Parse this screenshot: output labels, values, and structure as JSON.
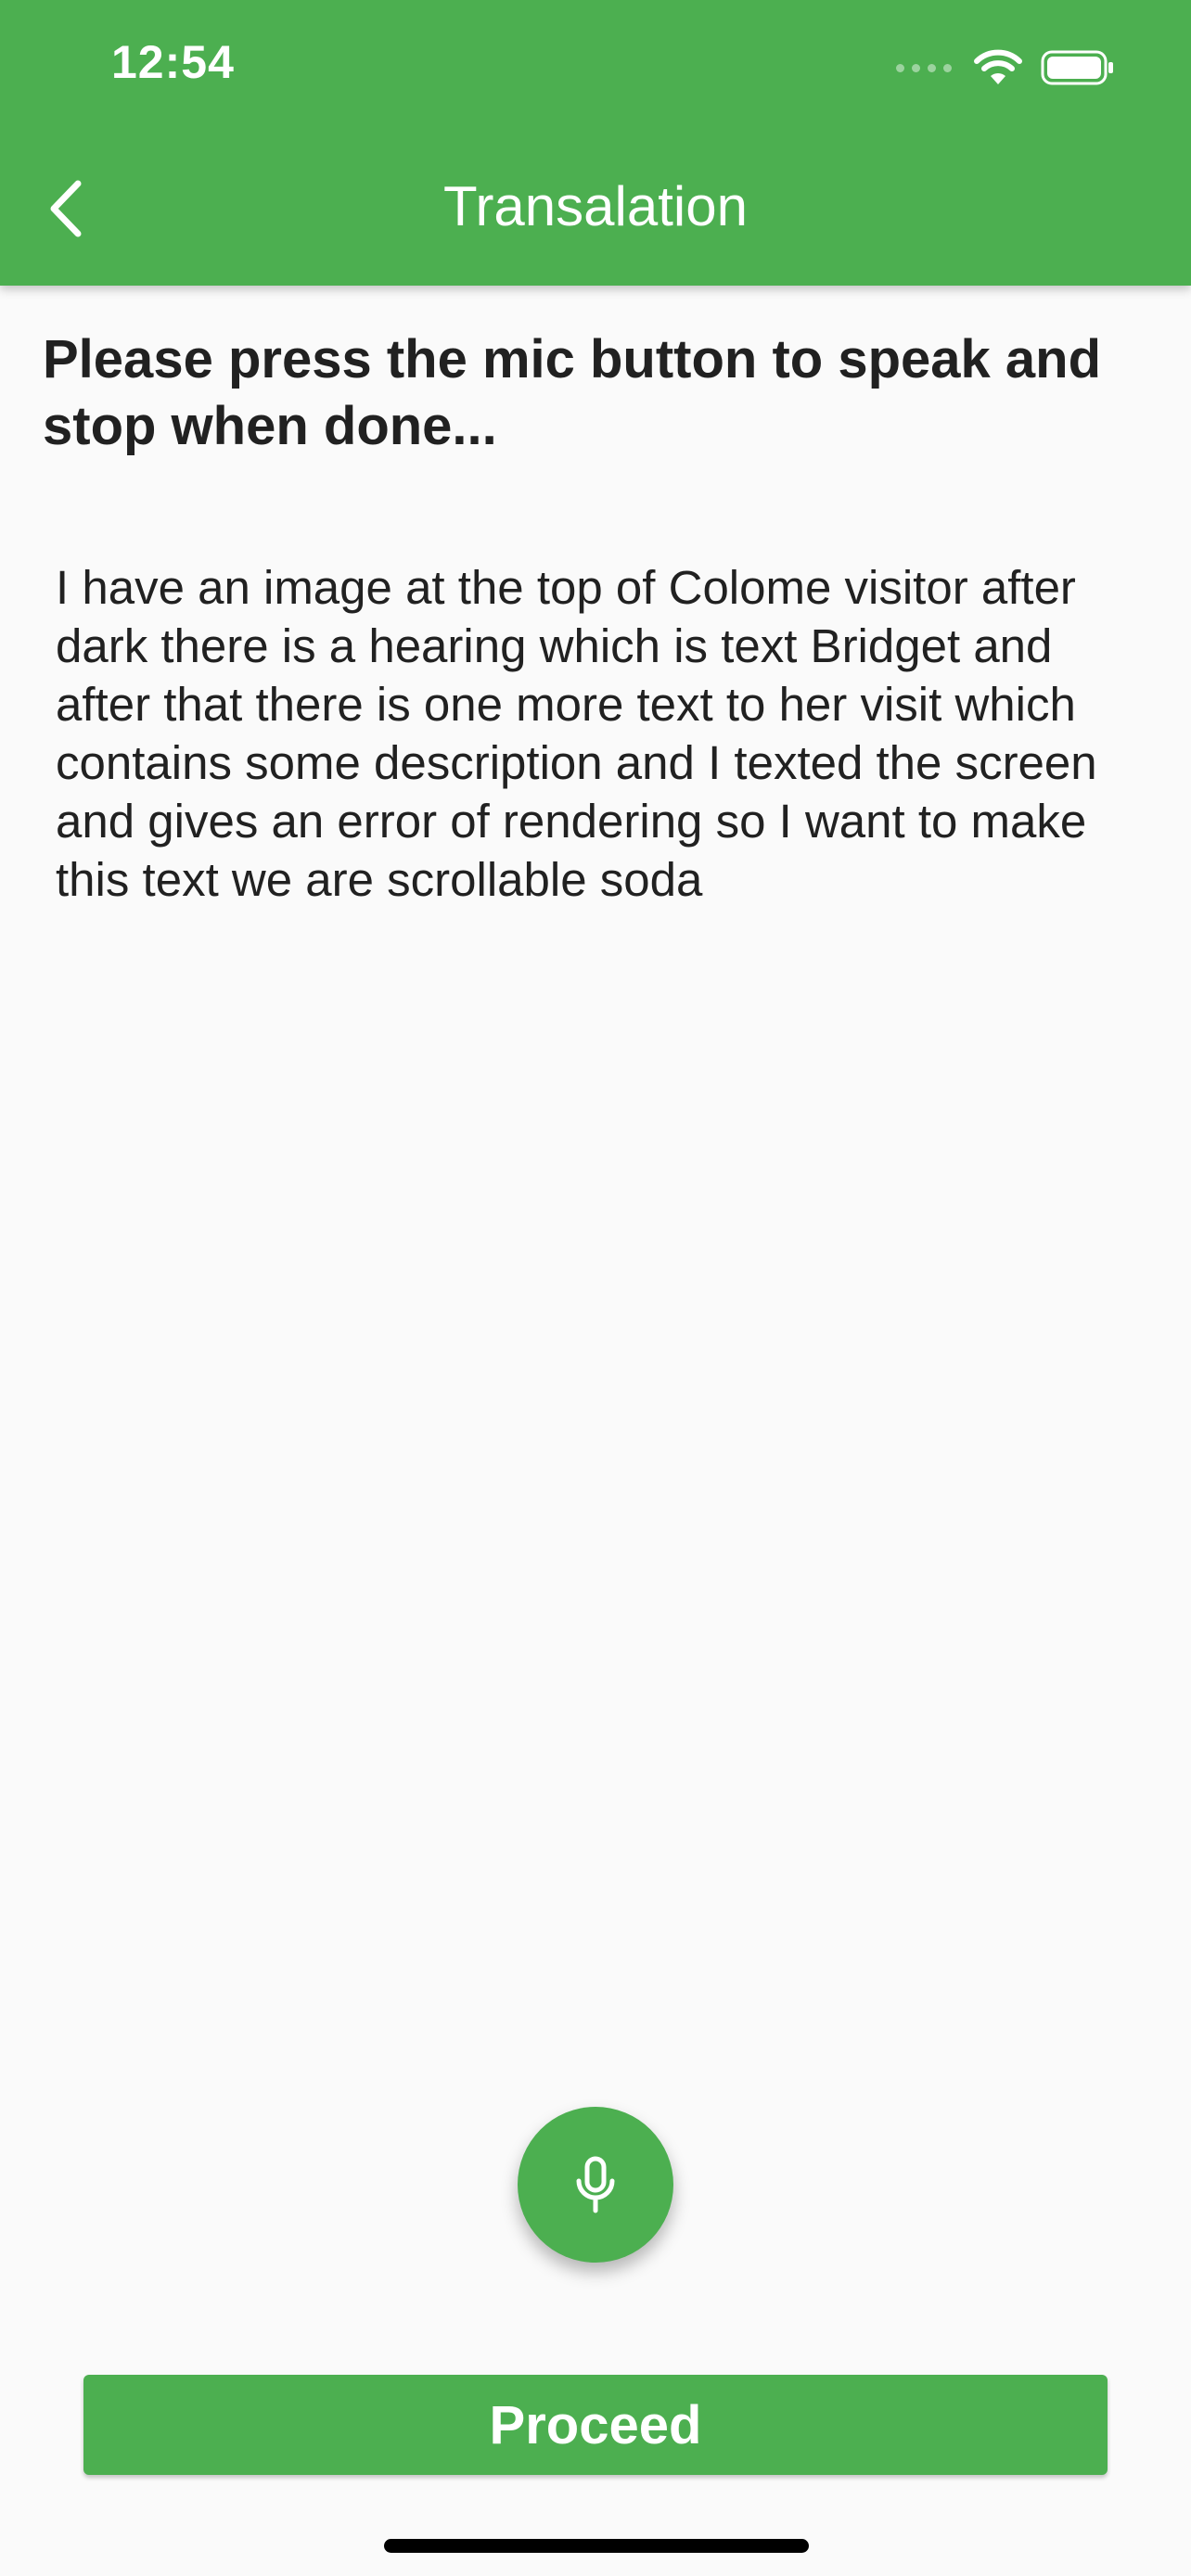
{
  "status_bar": {
    "time": "12:54"
  },
  "header": {
    "title": "Transalation",
    "back_icon": "chevron-left-icon"
  },
  "instruction": {
    "text": "Please press the mic button to speak and stop when done..."
  },
  "transcript": {
    "text": "I have an image at the top of Colome visitor after dark there is a hearing which is text Bridget and after that there is one more text to her visit which contains some description and I texted the screen and gives an error of rendering so I want to make this text we are scrollable soda"
  },
  "mic_button": {
    "icon": "microphone-icon"
  },
  "proceed_button": {
    "label": "Proceed"
  },
  "colors": {
    "primary": "#4caf50",
    "background": "#fafafa",
    "text": "#212121"
  }
}
